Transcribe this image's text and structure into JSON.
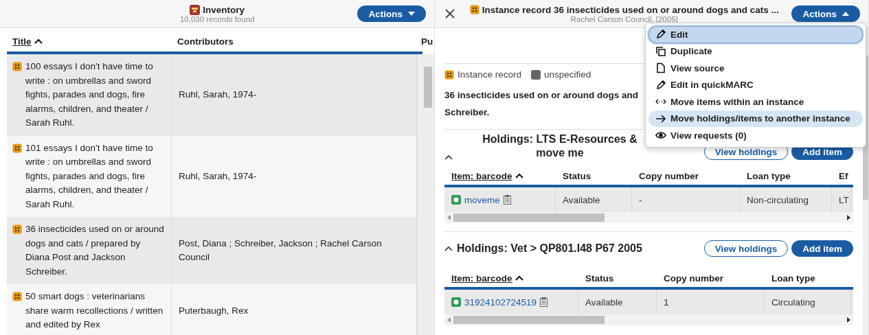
{
  "left_pane": {
    "title": "Inventory",
    "subtitle": "10,030 records found",
    "actions_button": {
      "label": "Actions",
      "expanded": false
    },
    "table": {
      "columns": [
        {
          "label": "Title",
          "sorted": true
        },
        {
          "label": "Contributors",
          "sorted": false
        },
        {
          "label": "Pu"
        }
      ],
      "rows": [
        {
          "title": "100 essays I don't have time to write : on umbrellas and sword fights, parades and dogs, fire alarms, children, and theater / Sarah Ruhl.",
          "contributors": "Ruhl, Sarah, 1974-"
        },
        {
          "title": "101 essays I don't have time to write : on umbrellas and sword fights, parades and dogs, fire alarms, children, and theater / Sarah Ruhl.",
          "contributors": "Ruhl, Sarah, 1974-"
        },
        {
          "title": "36 insecticides used on or around dogs and cats / prepared by Diana Post and Jackson Schreiber.",
          "contributors": "Post, Diana ; Schreiber, Jackson ; Rachel Carson Council"
        },
        {
          "title": "50 smart dogs : veterinarians share warm recollections / written and edited by Rex",
          "contributors": "Puterbaugh, Rex"
        }
      ]
    }
  },
  "detail_pane": {
    "title": "Instance record 36 insecticides used on or around dogs and cats ...",
    "subtitle": "Rachel Carson Council, [2005]",
    "actions_button": {
      "label": "Actions",
      "expanded": true
    },
    "actions_menu": [
      {
        "label": "Edit",
        "kind": "pencil",
        "focused": true,
        "hovered": false
      },
      {
        "label": "Duplicate",
        "kind": "copy",
        "focused": false,
        "hovered": false
      },
      {
        "label": "View source",
        "kind": "file",
        "focused": false,
        "hovered": false
      },
      {
        "label": "Edit in quickMARC",
        "kind": "pencil",
        "focused": false,
        "hovered": false
      },
      {
        "label": "Move items within an instance",
        "kind": "move",
        "focused": false,
        "hovered": false
      },
      {
        "label": "Move holdings/items to another instance",
        "kind": "arrow",
        "focused": false,
        "hovered": true
      },
      {
        "label": "View requests (0)",
        "kind": "eye",
        "focused": false,
        "hovered": false
      }
    ],
    "tags": [
      {
        "label": "Instance record",
        "kind": "instance"
      },
      {
        "label": "unspecified",
        "kind": "status"
      }
    ],
    "record_title_lines": [
      "36 insecticides used on or around dogs and",
      "Schreiber."
    ],
    "holdings": [
      {
        "heading_lines": [
          "Holdings: LTS E-Resources &",
          "move me"
        ],
        "buttons": [
          "View holdings",
          "Add item"
        ],
        "columns": [
          {
            "label": "Item: barcode",
            "sorted": true
          },
          {
            "label": "Status",
            "sorted": false
          },
          {
            "label": "Copy number",
            "sorted": false
          },
          {
            "label": "Loan type",
            "sorted": false
          },
          {
            "label": "Ef",
            "sorted": false
          }
        ],
        "rows": [
          {
            "cells": [
              "moveme",
              "Available",
              "-",
              "Non-circulating",
              "LT"
            ]
          }
        ]
      },
      {
        "heading_lines": [
          "Holdings: Vet > QP801.I48 P67 2005"
        ],
        "buttons": [
          "View holdings",
          "Add item"
        ],
        "columns": [
          {
            "label": "Item: barcode",
            "sorted": true
          },
          {
            "label": "Status",
            "sorted": false
          },
          {
            "label": "Copy number",
            "sorted": false
          },
          {
            "label": "Loan type",
            "sorted": false
          }
        ],
        "rows": [
          {
            "cells": [
              "31924102724519",
              "Available",
              "1",
              "Circulating"
            ]
          }
        ]
      }
    ]
  }
}
